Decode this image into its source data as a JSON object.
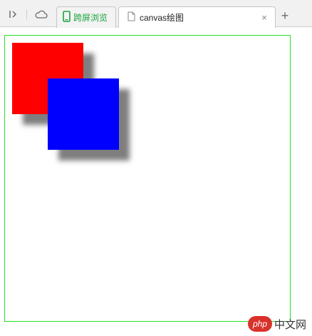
{
  "browser": {
    "tabs": [
      {
        "label": "跨屏浏览",
        "icon": "phone-icon",
        "active": false,
        "color": "#19a33b"
      },
      {
        "label": "canvas绘图",
        "icon": "document-icon",
        "active": true
      }
    ],
    "close_glyph": "×",
    "newtab_glyph": "+"
  },
  "canvas": {
    "border_color": "#28e028",
    "shapes": [
      {
        "name": "red-square",
        "fill": "#ff0000",
        "shadow": "#5a5a5a"
      },
      {
        "name": "blue-square",
        "fill": "#0000ff",
        "shadow": "#5a5a5a"
      }
    ]
  },
  "watermark": {
    "badge": "php",
    "text": "中文网"
  }
}
